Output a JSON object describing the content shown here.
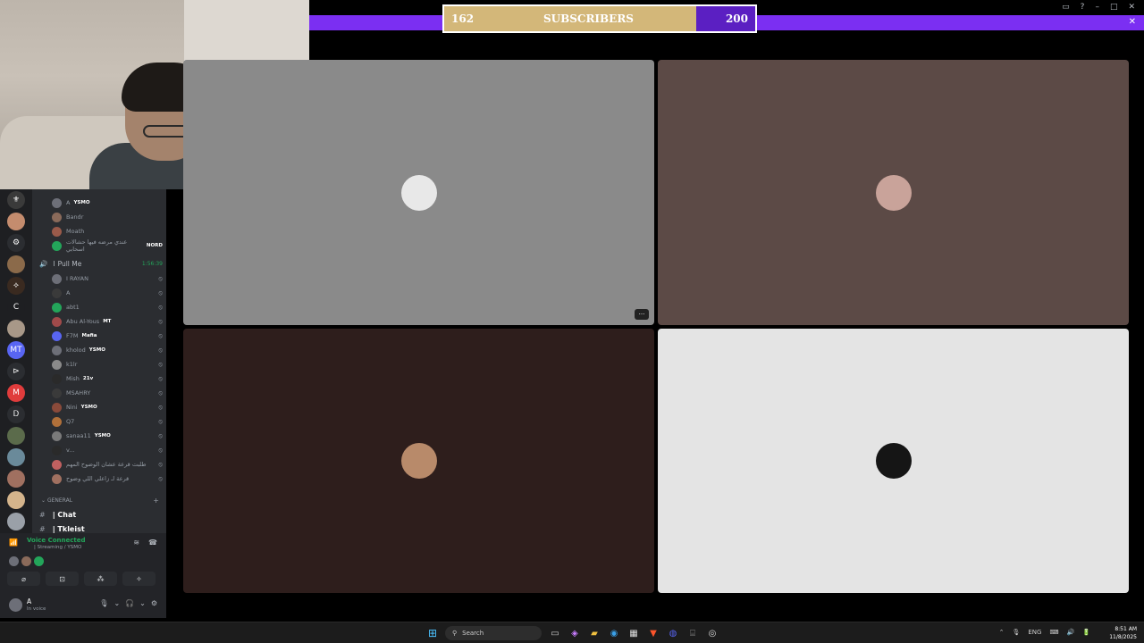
{
  "subscriber_goal": {
    "current": "162",
    "label": "SUBSCRIBERS",
    "target": "200",
    "progress_fraction": 0.81,
    "fill_color": "#d3b779",
    "bar_color": "#7b2ff2"
  },
  "window_controls": {
    "cast": "▭",
    "help": "?",
    "minimize": "–",
    "maximize": "□",
    "close": "✕",
    "overlay_close": "✕"
  },
  "server_list": [
    {
      "icon": "⚜",
      "color": "#3a3a3a"
    },
    {
      "icon": "",
      "color": "#c48c6e"
    },
    {
      "icon": "⚙",
      "color": "#2b2d31"
    },
    {
      "icon": "",
      "color": "#8b6a4a"
    },
    {
      "icon": "⟡",
      "color": "#3a2a20"
    },
    {
      "icon": "C",
      "color": "#1e1f22"
    },
    {
      "icon": "",
      "color": "#a89888"
    },
    {
      "icon": "MT",
      "color": "#5865f2"
    },
    {
      "icon": "⊳",
      "color": "#2b2d31"
    },
    {
      "icon": "M",
      "color": "#e03c3c"
    },
    {
      "icon": "Ꭰ",
      "color": "#2b2d31"
    },
    {
      "icon": "",
      "color": "#5b6b4b"
    },
    {
      "icon": "",
      "color": "#6a8a9a"
    },
    {
      "icon": "",
      "color": "#a07060"
    },
    {
      "icon": "",
      "color": "#d4b48c"
    },
    {
      "icon": "",
      "color": "#9aa0a8"
    }
  ],
  "voice_channel": {
    "above_members": [
      {
        "name": "A",
        "tag": "YSMO",
        "color": "#6d6f78"
      },
      {
        "name": "Bandr",
        "tag": "",
        "color": "#8a6a5a"
      },
      {
        "name": "Moath",
        "tag": "",
        "color": "#9a5a4a"
      },
      {
        "name": "عندي مرضه فيها حشالات اسحابي",
        "tag": "NORD",
        "color": "#23a55a"
      }
    ],
    "name": "Pull Me",
    "prefix": "I",
    "timer": "1:56:39",
    "members": [
      {
        "name": "I RAYAN",
        "tag": "",
        "color": "#6d6f78"
      },
      {
        "name": "A",
        "tag": "",
        "color": "#3a3a3a"
      },
      {
        "name": "abt1",
        "tag": "",
        "color": "#23a55a"
      },
      {
        "name": "Abu Al-Yous",
        "tag": "MT",
        "color": "#a04a4a"
      },
      {
        "name": "F7M",
        "tag": "Mafia",
        "color": "#5865f2"
      },
      {
        "name": "kholod",
        "tag": "YSMO",
        "color": "#6d6f78"
      },
      {
        "name": "k1lr",
        "tag": "",
        "color": "#8a8a8a"
      },
      {
        "name": "Mish",
        "tag": "21v",
        "color": "#2a2a2a"
      },
      {
        "name": "MSAHRY",
        "tag": "",
        "color": "#3a3a3a"
      },
      {
        "name": "Nini",
        "tag": "YSMO",
        "color": "#8a4a3a"
      },
      {
        "name": "Q7",
        "tag": "",
        "color": "#b0703a"
      },
      {
        "name": "sanaa11",
        "tag": "YSMO",
        "color": "#7a7a7a"
      },
      {
        "name": "v...",
        "tag": "",
        "color": "#2a2a2a"
      },
      {
        "name": "طلبت قرعة عشان الوضوح المهم",
        "tag": "",
        "color": "#c06060"
      },
      {
        "name": "قرعة لـ زاعلي اللي وضوح",
        "tag": "",
        "color": "#a07060"
      }
    ]
  },
  "category": {
    "label": "GENERAL",
    "plus": "+"
  },
  "text_channels": [
    {
      "name": "| Chat"
    },
    {
      "name": "| Tkleist"
    }
  ],
  "voice_panel": {
    "title": "Voice Connected",
    "subtitle": "| Streaming / YSMO",
    "buttons": [
      "⌀",
      "⊡",
      "⁂",
      "✧"
    ]
  },
  "user_panel": {
    "name": "A",
    "status": "In voice"
  },
  "stage_tiles": [
    {
      "bg": "#8a8a8a",
      "avatar": "#e8e8e8",
      "more": "···"
    },
    {
      "bg": "#5c4a46",
      "avatar": "#c9a39a",
      "more": ""
    },
    {
      "bg": "#2e1e1c",
      "avatar": "#b88a6a",
      "more": ""
    },
    {
      "bg": "#e4e4e4",
      "avatar": "#151515",
      "more": ""
    }
  ],
  "taskbar": {
    "start_icon": "⊞",
    "search_placeholder": "Search",
    "apps": [
      {
        "name": "task-view",
        "glyph": "▭",
        "color": "#cccccc"
      },
      {
        "name": "copilot",
        "glyph": "◈",
        "color": "#c87dff"
      },
      {
        "name": "files",
        "glyph": "▰",
        "color": "#f0c040"
      },
      {
        "name": "edge",
        "glyph": "◉",
        "color": "#3aa0e8"
      },
      {
        "name": "store",
        "glyph": "▦",
        "color": "#dddddd"
      },
      {
        "name": "brave",
        "glyph": "▼",
        "color": "#fb542b"
      },
      {
        "name": "discord",
        "glyph": "◍",
        "color": "#5865f2"
      },
      {
        "name": "terminal",
        "glyph": "⌸",
        "color": "#888888"
      },
      {
        "name": "chrome",
        "glyph": "◎",
        "color": "#dddddd"
      }
    ],
    "tray": [
      "⌃",
      "🎙",
      "ENG",
      "⌨",
      "🔊",
      "🔋"
    ],
    "time": "8:51 AM",
    "date": "11/8/2025"
  }
}
